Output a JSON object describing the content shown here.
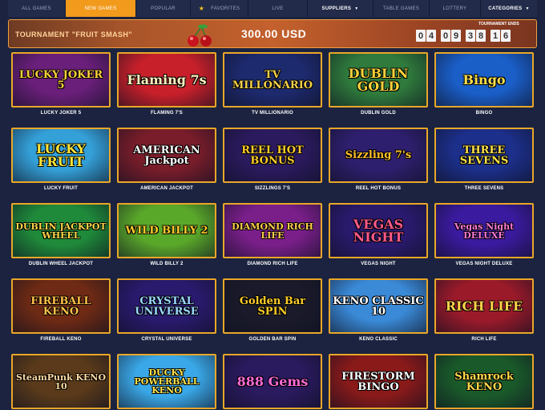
{
  "nav": {
    "items": [
      {
        "label": "ALL GAMES"
      },
      {
        "label": "NEW GAMES"
      },
      {
        "label": "POPULAR"
      },
      {
        "label": "FAVORITES"
      },
      {
        "label": "LIVE"
      },
      {
        "label": "SUPPLIERS"
      },
      {
        "label": "TABLE GAMES"
      },
      {
        "label": "LOTTERY"
      },
      {
        "label": "CATEGORIES"
      }
    ],
    "active_index": 1
  },
  "banner": {
    "title": "TOURNAMENT \"FRUIT SMASH\"",
    "prize": "300.00 USD",
    "ends_label": "TOURNAMENT ENDS",
    "countdown": [
      "0",
      "4",
      "0",
      "9",
      "3",
      "8",
      "1",
      "6"
    ]
  },
  "games": [
    {
      "name": "LUCKY JOKER 5",
      "art": "LUCKY JOKER 5",
      "bg": "#6a1f7a",
      "fg": "#ffd23a"
    },
    {
      "name": "FLAMING 7'S",
      "art": "Flaming 7s",
      "bg": "#c8202a",
      "fg": "#fff4c0"
    },
    {
      "name": "TV MILLIONARIO",
      "art": "TV MILLONARIO",
      "bg": "#1d2a6e",
      "fg": "#f5d14a"
    },
    {
      "name": "DUBLIN GOLD",
      "art": "DUBLIN GOLD",
      "bg": "#2f7a3c",
      "fg": "#ffd23a"
    },
    {
      "name": "BINGO",
      "art": "Bingo",
      "bg": "#1a5ec8",
      "fg": "#ffe04a"
    },
    {
      "name": "LUCKY FRUIT",
      "art": "LUCKY FRUIT",
      "bg": "#34a0d8",
      "fg": "#ffe63a"
    },
    {
      "name": "AMERICAN JACKPOT",
      "art": "AMERICAN Jackpot",
      "bg": "#7a1d2a",
      "fg": "#ffffff"
    },
    {
      "name": "SIZZLINGS 7'S",
      "art": "REEL HOT BONUS",
      "bg": "#2b1a5e",
      "fg": "#ffcc2a"
    },
    {
      "name": "REEL HOT BONUS",
      "art": "Sizzling 7's",
      "bg": "#2e1f6e",
      "fg": "#ffbf2a"
    },
    {
      "name": "THREE SEVENS",
      "art": "THREE SEVENS",
      "bg": "#1c2f8a",
      "fg": "#ffe34a"
    },
    {
      "name": "DUBLIN WHEEL JACKPOT",
      "art": "DUBLIN JACKPOT WHEEL",
      "bg": "#1f8a3a",
      "fg": "#ffd84a"
    },
    {
      "name": "WILD BILLY 2",
      "art": "WILD BILLY 2",
      "bg": "#5aa82a",
      "fg": "#ffcc2a"
    },
    {
      "name": "DIAMOND RICH LIFE",
      "art": "DIAMOND RICH LIFE",
      "bg": "#7a1f8a",
      "fg": "#ffd04a"
    },
    {
      "name": "VEGAS NIGHT",
      "art": "VEGAS NIGHT",
      "bg": "#2a1a6e",
      "fg": "#ff5a8a"
    },
    {
      "name": "VEGAS NIGHT DELUXE",
      "art": "Vegas Night DELUXE",
      "bg": "#3a1a9e",
      "fg": "#ff7ad8"
    },
    {
      "name": "FIREBALL KENO",
      "art": "FIREBALL KENO",
      "bg": "#6e2a14",
      "fg": "#ffc24a"
    },
    {
      "name": "CRYSTAL UNIVERSE",
      "art": "CRYSTAL UNIVERSE",
      "bg": "#2a1a6e",
      "fg": "#9ad8ff"
    },
    {
      "name": "GOLDEN BAR SPIN",
      "art": "Golden Bar SPIN",
      "bg": "#1a1a2a",
      "fg": "#ffcc2a"
    },
    {
      "name": "KENO CLASSIC",
      "art": "KENO CLASSIC 10",
      "bg": "#3a8ad8",
      "fg": "#ffffff"
    },
    {
      "name": "RICH LIFE",
      "art": "RICH LIFE",
      "bg": "#9a1a2a",
      "fg": "#ffd24a"
    },
    {
      "name": "",
      "art": "SteamPunk KENO 10",
      "bg": "#5a3a1a",
      "fg": "#ffd9a0"
    },
    {
      "name": "",
      "art": "DUCKY POWERBALL KENO",
      "bg": "#3aa8e8",
      "fg": "#ffe24a"
    },
    {
      "name": "",
      "art": "888 Gems",
      "bg": "#2a1a5e",
      "fg": "#ff6ad8"
    },
    {
      "name": "",
      "art": "FIRESTORM BINGO",
      "bg": "#8a1a1a",
      "fg": "#ffffff"
    },
    {
      "name": "",
      "art": "Shamrock KENO",
      "bg": "#1a5a2a",
      "fg": "#ffd84a"
    }
  ]
}
